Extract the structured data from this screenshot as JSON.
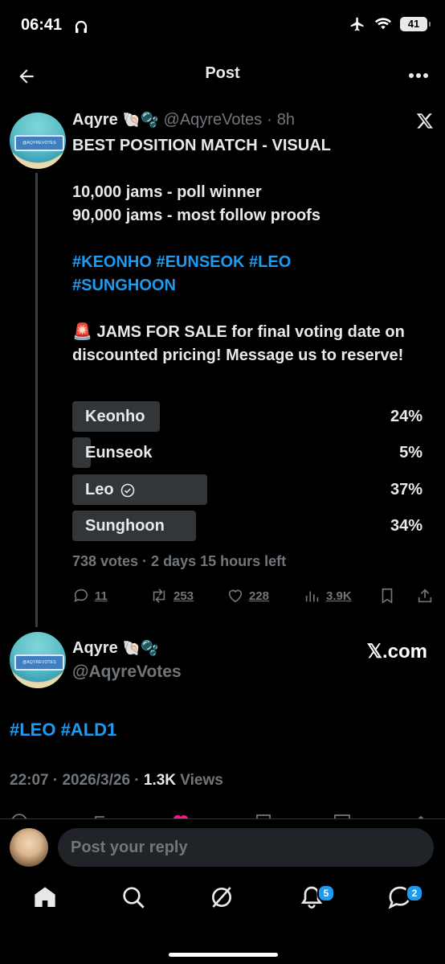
{
  "status_bar": {
    "time": "06:41",
    "battery": "41"
  },
  "header": {
    "title": "Post"
  },
  "tweet": {
    "author_name": "Aqyre",
    "author_emoji": "🐚🫧",
    "handle": "@AqyreVotes",
    "separator": "·",
    "time_ago": "8h",
    "avatar_text": "@AQYREVOTES",
    "lines": {
      "l1": "BEST POSITION MATCH - VISUAL",
      "l2": "10,000 jams - poll winner",
      "l3": "90,000 jams - most follow proofs",
      "l4": "#KEONHO #EUNSEOK #LEO",
      "l5": "#SUNGHOON",
      "l6": "🚨 JAMS FOR SALE for final voting date on discounted pricing! Message us to reserve!"
    },
    "poll": {
      "options": [
        {
          "label": "Keonho",
          "percent": "24%",
          "value": 24,
          "selected": false
        },
        {
          "label": "Eunseok",
          "percent": "5%",
          "value": 5,
          "selected": false
        },
        {
          "label": "Leo",
          "percent": "37%",
          "value": 37,
          "selected": true
        },
        {
          "label": "Sunghoon",
          "percent": "34%",
          "value": 34,
          "selected": false
        }
      ],
      "meta": "738 votes · 2 days 15 hours left"
    },
    "stats": {
      "replies": "11",
      "reposts": "253",
      "likes": "228",
      "views": "3.9K"
    }
  },
  "quoted": {
    "author_name": "Aqyre",
    "author_emoji": "🐚🫧",
    "handle": "@AqyreVotes",
    "source": "𝕏.com",
    "tags": "#LEO #ALD1",
    "timestamp": "22:07 · 2026/3/26 · ",
    "views_count": "1.3K",
    "views_label": " Views"
  },
  "reply": {
    "placeholder": "Post your reply"
  },
  "tabbar": {
    "notifications_badge": "5",
    "messages_badge": "2"
  },
  "colors": {
    "accent": "#1d9bf0",
    "background": "#000000",
    "muted": "#71767b"
  }
}
